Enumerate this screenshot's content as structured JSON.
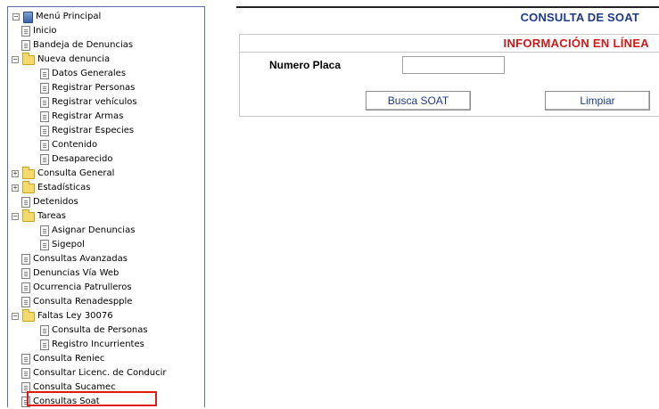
{
  "header": {
    "title": "CONSULTA DE SOAT",
    "subtitle": "INFORMACIÓN EN LÍNEA"
  },
  "form": {
    "plate_label": "Numero Placa",
    "plate_value": "",
    "search_button": "Busca SOAT",
    "clear_button": "Limpiar"
  },
  "tree": {
    "items": [
      {
        "label": "Menú Principal",
        "depth": 0,
        "kind": "root",
        "expander": "−"
      },
      {
        "label": "Inicio",
        "depth": 1,
        "kind": "doc"
      },
      {
        "label": "Bandeja de Denuncias",
        "depth": 1,
        "kind": "doc"
      },
      {
        "label": "Nueva denuncia",
        "depth": 1,
        "kind": "folder",
        "expander": "−"
      },
      {
        "label": "Datos Generales",
        "depth": 2,
        "kind": "doc"
      },
      {
        "label": "Registrar Personas",
        "depth": 2,
        "kind": "doc"
      },
      {
        "label": "Registrar vehículos",
        "depth": 2,
        "kind": "doc"
      },
      {
        "label": "Registrar Armas",
        "depth": 2,
        "kind": "doc"
      },
      {
        "label": "Registrar Especies",
        "depth": 2,
        "kind": "doc"
      },
      {
        "label": "Contenido",
        "depth": 2,
        "kind": "doc"
      },
      {
        "label": "Desaparecido",
        "depth": 2,
        "kind": "doc"
      },
      {
        "label": "Consulta General",
        "depth": 1,
        "kind": "folder",
        "expander": "+"
      },
      {
        "label": "Estadísticas",
        "depth": 1,
        "kind": "folder",
        "expander": "+"
      },
      {
        "label": "Detenidos",
        "depth": 1,
        "kind": "doc"
      },
      {
        "label": "Tareas",
        "depth": 1,
        "kind": "folder",
        "expander": "−"
      },
      {
        "label": "Asignar Denuncias",
        "depth": 2,
        "kind": "doc"
      },
      {
        "label": "Sigepol",
        "depth": 2,
        "kind": "doc"
      },
      {
        "label": "Consultas Avanzadas",
        "depth": 1,
        "kind": "doc"
      },
      {
        "label": "Denuncias Vía Web",
        "depth": 1,
        "kind": "doc"
      },
      {
        "label": "Ocurrencia Patrulleros",
        "depth": 1,
        "kind": "doc"
      },
      {
        "label": "Consulta Renadespple",
        "depth": 1,
        "kind": "doc"
      },
      {
        "label": "Faltas Ley 30076",
        "depth": 1,
        "kind": "folder",
        "expander": "−"
      },
      {
        "label": "Consulta de Personas",
        "depth": 2,
        "kind": "doc"
      },
      {
        "label": "Registro Incurrientes",
        "depth": 2,
        "kind": "doc"
      },
      {
        "label": "Consulta Reniec",
        "depth": 1,
        "kind": "doc"
      },
      {
        "label": "Consultar Licenc. de Conducir",
        "depth": 1,
        "kind": "doc"
      },
      {
        "label": "Consulta Sucamec",
        "depth": 1,
        "kind": "doc"
      },
      {
        "label": "Consultas Soat",
        "depth": 1,
        "kind": "doc",
        "selected": true
      }
    ]
  },
  "colors": {
    "title": "#1f3a8a",
    "subtitle": "#d01818",
    "highlight": "#e01818"
  }
}
